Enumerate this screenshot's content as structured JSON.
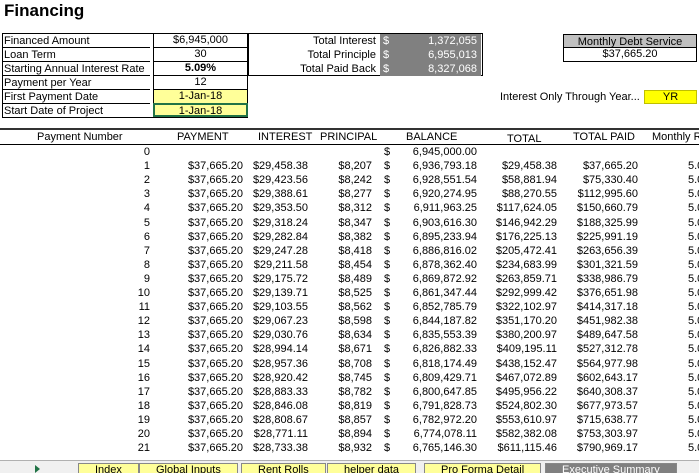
{
  "title": "Financing",
  "inputs": [
    {
      "label": "Financed Amount",
      "value": "$6,945,000"
    },
    {
      "label": "Loan Term",
      "value": "30"
    },
    {
      "label": "Starting Annual Interest Rate",
      "value": "5.09%"
    },
    {
      "label": "Payment per Year",
      "value": "12"
    },
    {
      "label": "First Payment Date",
      "value": "1-Jan-18"
    },
    {
      "label": "Start Date of Project",
      "value": "1-Jan-18"
    }
  ],
  "totals": [
    {
      "label": "Total Interest",
      "dollar": "$",
      "value": "1,372,055"
    },
    {
      "label": "Total Principle",
      "dollar": "$",
      "value": "6,955,013"
    },
    {
      "label": "Total Paid Back",
      "dollar": "$",
      "value": "8,327,068"
    }
  ],
  "monthly_debt_service": {
    "label": "Monthly Debt Service",
    "value": "$37,665.20"
  },
  "interest_only": {
    "label": "Interest Only Through Year...",
    "value": "YR"
  },
  "headers": {
    "num": "Payment Number",
    "payment": "PAYMENT",
    "interest": "INTEREST",
    "principal": "PRINCIPAL",
    "balance": "BALANCE",
    "total": "TOTAL",
    "total_paid": "TOTAL PAID",
    "monthly": "Monthly R"
  },
  "rows": [
    {
      "n": "0",
      "pay": "",
      "int": "",
      "prin": "",
      "dol": "$",
      "bal": "6,945,000.00",
      "tot": "",
      "tp": "",
      "mr": ""
    },
    {
      "n": "1",
      "pay": "$37,665.20",
      "int": "$29,458.38",
      "prin": "$8,207",
      "dol": "$",
      "bal": "6,936,793.18",
      "tot": "$29,458.38",
      "tp": "$37,665.20",
      "mr": "5.0"
    },
    {
      "n": "2",
      "pay": "$37,665.20",
      "int": "$29,423.56",
      "prin": "$8,242",
      "dol": "$",
      "bal": "6,928,551.54",
      "tot": "$58,881.94",
      "tp": "$75,330.40",
      "mr": "5.0"
    },
    {
      "n": "3",
      "pay": "$37,665.20",
      "int": "$29,388.61",
      "prin": "$8,277",
      "dol": "$",
      "bal": "6,920,274.95",
      "tot": "$88,270.55",
      "tp": "$112,995.60",
      "mr": "5.0"
    },
    {
      "n": "4",
      "pay": "$37,665.20",
      "int": "$29,353.50",
      "prin": "$8,312",
      "dol": "$",
      "bal": "6,911,963.25",
      "tot": "$117,624.05",
      "tp": "$150,660.79",
      "mr": "5.0"
    },
    {
      "n": "5",
      "pay": "$37,665.20",
      "int": "$29,318.24",
      "prin": "$8,347",
      "dol": "$",
      "bal": "6,903,616.30",
      "tot": "$146,942.29",
      "tp": "$188,325.99",
      "mr": "5.0"
    },
    {
      "n": "6",
      "pay": "$37,665.20",
      "int": "$29,282.84",
      "prin": "$8,382",
      "dol": "$",
      "bal": "6,895,233.94",
      "tot": "$176,225.13",
      "tp": "$225,991.19",
      "mr": "5.0"
    },
    {
      "n": "7",
      "pay": "$37,665.20",
      "int": "$29,247.28",
      "prin": "$8,418",
      "dol": "$",
      "bal": "6,886,816.02",
      "tot": "$205,472.41",
      "tp": "$263,656.39",
      "mr": "5.0"
    },
    {
      "n": "8",
      "pay": "$37,665.20",
      "int": "$29,211.58",
      "prin": "$8,454",
      "dol": "$",
      "bal": "6,878,362.40",
      "tot": "$234,683.99",
      "tp": "$301,321.59",
      "mr": "5.0"
    },
    {
      "n": "9",
      "pay": "$37,665.20",
      "int": "$29,175.72",
      "prin": "$8,489",
      "dol": "$",
      "bal": "6,869,872.92",
      "tot": "$263,859.71",
      "tp": "$338,986.79",
      "mr": "5.0"
    },
    {
      "n": "10",
      "pay": "$37,665.20",
      "int": "$29,139.71",
      "prin": "$8,525",
      "dol": "$",
      "bal": "6,861,347.44",
      "tot": "$292,999.42",
      "tp": "$376,651.98",
      "mr": "5.0"
    },
    {
      "n": "11",
      "pay": "$37,665.20",
      "int": "$29,103.55",
      "prin": "$8,562",
      "dol": "$",
      "bal": "6,852,785.79",
      "tot": "$322,102.97",
      "tp": "$414,317.18",
      "mr": "5.0"
    },
    {
      "n": "12",
      "pay": "$37,665.20",
      "int": "$29,067.23",
      "prin": "$8,598",
      "dol": "$",
      "bal": "6,844,187.82",
      "tot": "$351,170.20",
      "tp": "$451,982.38",
      "mr": "5.0"
    },
    {
      "n": "13",
      "pay": "$37,665.20",
      "int": "$29,030.76",
      "prin": "$8,634",
      "dol": "$",
      "bal": "6,835,553.39",
      "tot": "$380,200.97",
      "tp": "$489,647.58",
      "mr": "5.0"
    },
    {
      "n": "14",
      "pay": "$37,665.20",
      "int": "$28,994.14",
      "prin": "$8,671",
      "dol": "$",
      "bal": "6,826,882.33",
      "tot": "$409,195.11",
      "tp": "$527,312.78",
      "mr": "5.0"
    },
    {
      "n": "15",
      "pay": "$37,665.20",
      "int": "$28,957.36",
      "prin": "$8,708",
      "dol": "$",
      "bal": "6,818,174.49",
      "tot": "$438,152.47",
      "tp": "$564,977.98",
      "mr": "5.0"
    },
    {
      "n": "16",
      "pay": "$37,665.20",
      "int": "$28,920.42",
      "prin": "$8,745",
      "dol": "$",
      "bal": "6,809,429.71",
      "tot": "$467,072.89",
      "tp": "$602,643.17",
      "mr": "5.0"
    },
    {
      "n": "17",
      "pay": "$37,665.20",
      "int": "$28,883.33",
      "prin": "$8,782",
      "dol": "$",
      "bal": "6,800,647.85",
      "tot": "$495,956.22",
      "tp": "$640,308.37",
      "mr": "5.0"
    },
    {
      "n": "18",
      "pay": "$37,665.20",
      "int": "$28,846.08",
      "prin": "$8,819",
      "dol": "$",
      "bal": "6,791,828.73",
      "tot": "$524,802.30",
      "tp": "$677,973.57",
      "mr": "5.0"
    },
    {
      "n": "19",
      "pay": "$37,665.20",
      "int": "$28,808.67",
      "prin": "$8,857",
      "dol": "$",
      "bal": "6,782,972.20",
      "tot": "$553,610.97",
      "tp": "$715,638.77",
      "mr": "5.0"
    },
    {
      "n": "20",
      "pay": "$37,665.20",
      "int": "$28,771.11",
      "prin": "$8,894",
      "dol": "$",
      "bal": "6,774,078.11",
      "tot": "$582,382.08",
      "tp": "$753,303.97",
      "mr": "5.0"
    },
    {
      "n": "21",
      "pay": "$37,665.20",
      "int": "$28,733.38",
      "prin": "$8,932",
      "dol": "$",
      "bal": "6,765,146.30",
      "tot": "$611,115.46",
      "tp": "$790,969.17",
      "mr": "5.0"
    }
  ],
  "tabs": [
    {
      "label": "Index",
      "active": false
    },
    {
      "label": "Global Inputs",
      "active": false
    },
    {
      "label": "Rent Rolls",
      "active": false
    },
    {
      "label": "helper data",
      "active": false
    },
    {
      "label": "Pro Forma Detail",
      "active": false
    },
    {
      "label": "Executive Summary",
      "active": true
    }
  ]
}
